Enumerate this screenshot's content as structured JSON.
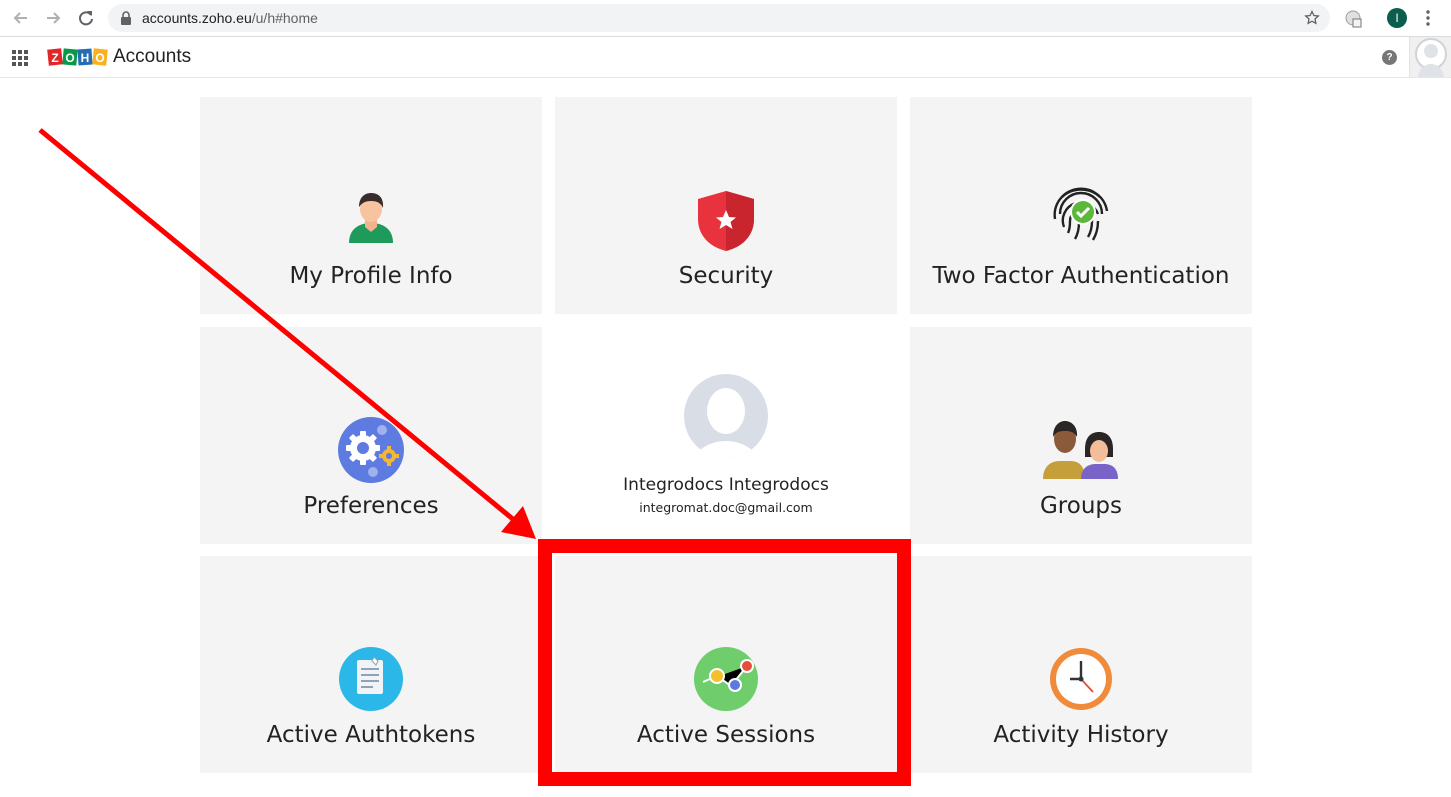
{
  "browser": {
    "url_host": "accounts.zoho.eu",
    "url_path": "/u/h#home",
    "profile_initial": "I"
  },
  "header": {
    "logo_letters": [
      "Z",
      "O",
      "H",
      "O"
    ],
    "title": "Accounts",
    "help_glyph": "?"
  },
  "tiles": [
    {
      "label": "My Profile Info",
      "icon": "profile-person-icon"
    },
    {
      "label": "Security",
      "icon": "security-shield-icon"
    },
    {
      "label": "Two Factor Authentication",
      "icon": "fingerprint-check-icon"
    },
    {
      "label": "Preferences",
      "icon": "gears-icon"
    },
    {
      "label": "Groups",
      "icon": "group-people-icon"
    },
    {
      "label": "Active Authtokens",
      "icon": "notepad-icon"
    },
    {
      "label": "Active Sessions",
      "icon": "session-graph-icon"
    },
    {
      "label": "Activity History",
      "icon": "clock-icon"
    }
  ],
  "profile": {
    "name": "Integrodocs Integrodocs",
    "email": "integromat.doc@gmail.com"
  },
  "annotation": {
    "color": "#ff0000",
    "highlighted_tile": "Active Sessions"
  }
}
